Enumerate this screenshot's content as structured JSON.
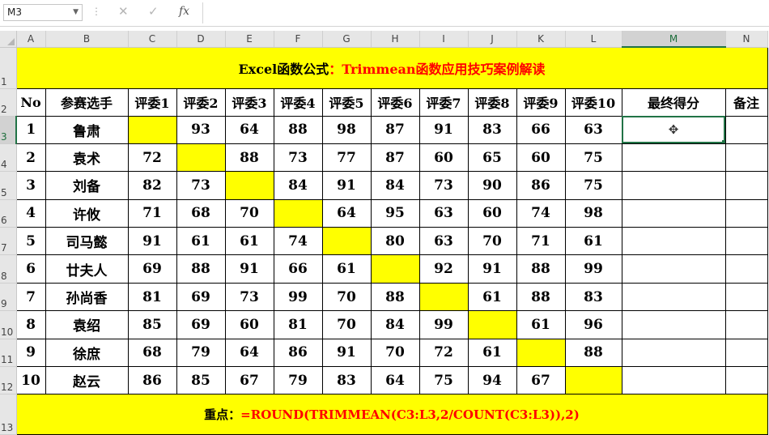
{
  "formula_bar": {
    "name_box": "M3",
    "cancel_icon": "✕",
    "enter_icon": "✓",
    "fx_label": "fx",
    "formula": ""
  },
  "columns": [
    "A",
    "B",
    "C",
    "D",
    "E",
    "F",
    "G",
    "H",
    "I",
    "J",
    "K",
    "L",
    "M",
    "N"
  ],
  "selected_column": "M",
  "rows": [
    "1",
    "2",
    "3",
    "4",
    "5",
    "6",
    "7",
    "8",
    "9",
    "10",
    "11",
    "12",
    "13"
  ],
  "selected_row": "3",
  "title": {
    "part1": "Excel函数公式",
    "part2": "：Trimmean函数应用技巧案例解读"
  },
  "headers": [
    "No",
    "参赛选手",
    "评委1",
    "评委2",
    "评委3",
    "评委4",
    "评委5",
    "评委6",
    "评委7",
    "评委8",
    "评委9",
    "评委10",
    "最终得分",
    "备注"
  ],
  "contestants": [
    {
      "no": "1",
      "name": "鲁肃",
      "scores": [
        "",
        "93",
        "64",
        "88",
        "98",
        "87",
        "91",
        "83",
        "66",
        "63"
      ]
    },
    {
      "no": "2",
      "name": "袁术",
      "scores": [
        "72",
        "",
        "88",
        "73",
        "77",
        "87",
        "60",
        "65",
        "60",
        "75"
      ]
    },
    {
      "no": "3",
      "name": "刘备",
      "scores": [
        "82",
        "73",
        "",
        "84",
        "91",
        "84",
        "73",
        "90",
        "86",
        "75"
      ]
    },
    {
      "no": "4",
      "name": "许攸",
      "scores": [
        "71",
        "68",
        "70",
        "",
        "64",
        "95",
        "63",
        "60",
        "74",
        "98"
      ]
    },
    {
      "no": "5",
      "name": "司马懿",
      "scores": [
        "91",
        "61",
        "61",
        "74",
        "",
        "80",
        "63",
        "70",
        "71",
        "61"
      ]
    },
    {
      "no": "6",
      "name": "廿夫人",
      "scores": [
        "69",
        "88",
        "91",
        "66",
        "61",
        "",
        "92",
        "91",
        "88",
        "99"
      ]
    },
    {
      "no": "7",
      "name": "孙尚香",
      "scores": [
        "81",
        "69",
        "73",
        "99",
        "70",
        "88",
        "",
        "61",
        "88",
        "83"
      ]
    },
    {
      "no": "8",
      "name": "袁绍",
      "scores": [
        "85",
        "69",
        "60",
        "81",
        "70",
        "84",
        "99",
        "",
        "61",
        "96"
      ]
    },
    {
      "no": "9",
      "name": "徐庶",
      "scores": [
        "68",
        "79",
        "64",
        "86",
        "91",
        "70",
        "72",
        "61",
        "",
        "88"
      ]
    },
    {
      "no": "10",
      "name": "赵云",
      "scores": [
        "86",
        "85",
        "67",
        "79",
        "83",
        "64",
        "75",
        "94",
        "67",
        ""
      ]
    }
  ],
  "bottom": {
    "label": "重点：",
    "formula": "=ROUND(TRIMMEAN(C3:L3,2/COUNT(C3:L3)),2)"
  },
  "colors": {
    "highlight": "#ffff00",
    "accent": "#217346",
    "red": "#ff0000"
  }
}
